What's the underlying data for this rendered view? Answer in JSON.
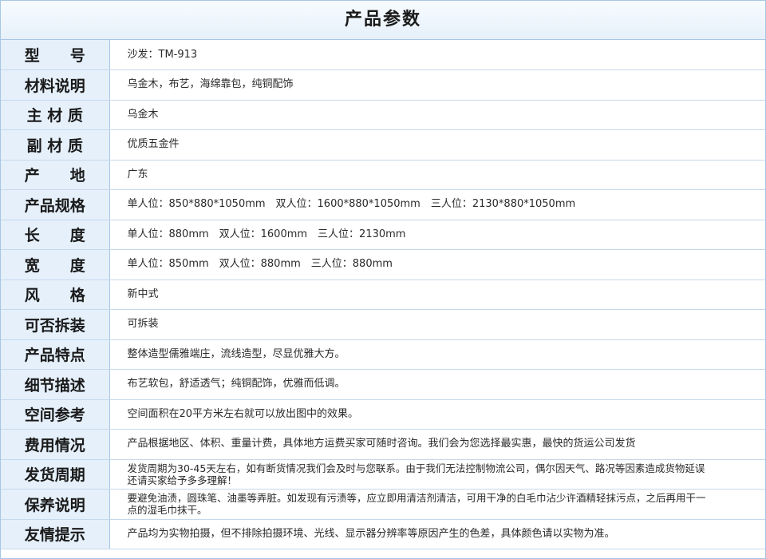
{
  "title": "产品参数",
  "rows": [
    {
      "label": "型　　号",
      "value": "沙发：TM-913"
    },
    {
      "label": "材料说明",
      "value": "乌金木，布艺，海绵靠包，纯铜配饰"
    },
    {
      "label": "主 材 质",
      "value": "乌金木"
    },
    {
      "label": "副 材 质",
      "value": "优质五金件"
    },
    {
      "label": "产　　地",
      "value": "广东"
    },
    {
      "label": "产品规格",
      "value": "单人位：850*880*1050mm　双人位：1600*880*1050mm　三人位：2130*880*1050mm"
    },
    {
      "label": "长　　度",
      "value": "单人位：880mm　双人位：1600mm　三人位：2130mm"
    },
    {
      "label": "宽　　度",
      "value": "单人位：850mm　双人位：880mm　三人位：880mm"
    },
    {
      "label": "风　　格",
      "value": "新中式"
    },
    {
      "label": "可否拆装",
      "value": "可拆装"
    },
    {
      "label": "产品特点",
      "value": "整体造型儒雅端庄，流线造型，尽显优雅大方。"
    },
    {
      "label": "细节描述",
      "value": "布艺软包，舒适透气；纯铜配饰，优雅而低调。"
    },
    {
      "label": "空间参考",
      "value": "空间面积在20平方米左右就可以放出图中的效果。"
    },
    {
      "label": "费用情况",
      "value": "产品根据地区、体积、重量计费，具体地方运费买家可随时咨询。我们会为您选择最实惠，最快的货运公司发货"
    },
    {
      "label": "发货周期",
      "value": "发货周期为30-45天左右，如有断货情况我们会及时与您联系。由于我们无法控制物流公司，偶尔因天气、路况等因素造成货物延误还请买家给予多多理解！"
    },
    {
      "label": "保养说明",
      "value": "要避免油渍，圆珠笔、油墨等弄脏。如发现有污渍等，应立即用清洁剂清洁，可用干净的白毛巾沾少许酒精轻抹污点，之后再用干一点的湿毛巾抹干。"
    },
    {
      "label": "友情提示",
      "value": "产品均为实物拍摄，但不排除拍摄环境、光线、显示器分辨率等原因产生的色差，具体颜色请以实物为准。"
    }
  ]
}
